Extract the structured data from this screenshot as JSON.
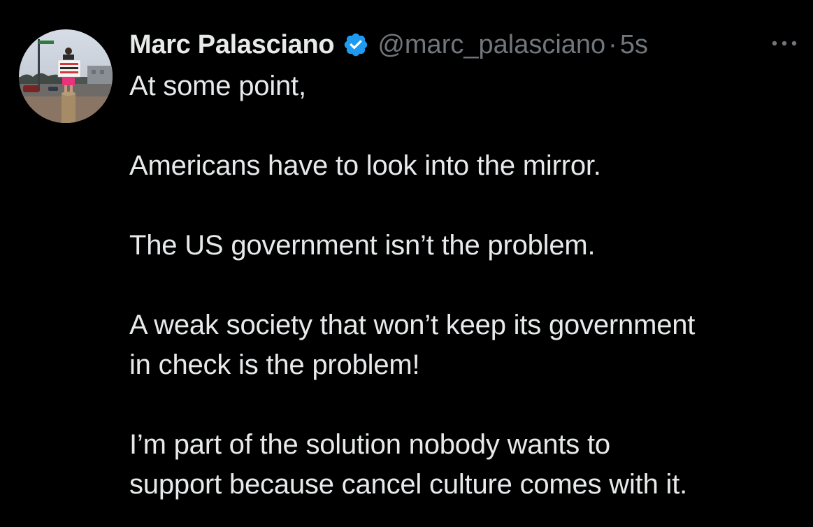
{
  "author": {
    "display_name": "Marc Palasciano",
    "handle": "@marc_palasciano",
    "separator": "·",
    "timestamp": "5s",
    "verified": true,
    "verified_color": "#1d9bf0",
    "avatar_icon": "profile-photo",
    "avatar_sign_text": [
      "FACEBOOK &",
      "BIG TECH",
      "CENSORED ME"
    ]
  },
  "menu": {
    "icon": "more-horizontal-icon"
  },
  "tweet": {
    "paragraphs": [
      {
        "lines": [
          "At some point,"
        ]
      },
      {
        "lines": [
          "Americans have to look into the mirror."
        ]
      },
      {
        "lines": [
          "The US government isn’t the problem."
        ]
      },
      {
        "lines": [
          "A weak society that won’t keep its government",
          "in check is the problem!"
        ]
      },
      {
        "lines": [
          "I’m part of the solution nobody wants to",
          "support because cancel culture comes with it."
        ]
      }
    ]
  },
  "colors": {
    "background": "#000000",
    "text": "#e7e9ea",
    "secondary": "#71767b"
  }
}
